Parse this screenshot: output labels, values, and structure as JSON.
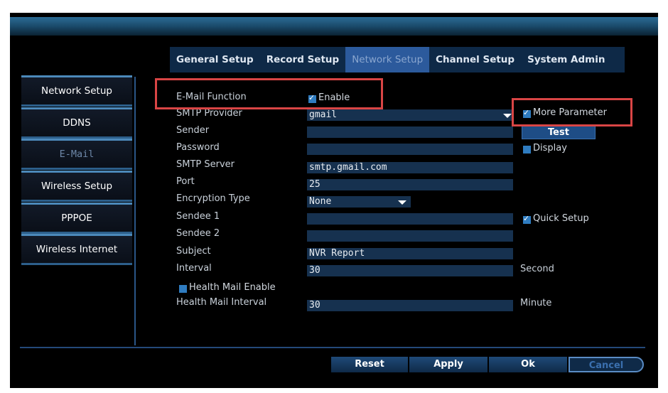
{
  "tabs": [
    {
      "label": "General Setup",
      "active": false
    },
    {
      "label": "Record Setup",
      "active": false
    },
    {
      "label": "Network Setup",
      "active": true
    },
    {
      "label": "Channel Setup",
      "active": false
    },
    {
      "label": "System Admin",
      "active": false
    }
  ],
  "sidebar": [
    {
      "label": "Network Setup",
      "active": false
    },
    {
      "label": "DDNS",
      "active": false
    },
    {
      "label": "E-Mail",
      "active": true
    },
    {
      "label": "Wireless Setup",
      "active": false
    },
    {
      "label": "PPPOE",
      "active": false
    },
    {
      "label": "Wireless Internet",
      "active": false
    }
  ],
  "email": {
    "function_label": "E-Mail Function",
    "enable_label": "Enable",
    "enable_checked": true,
    "smtp_provider_label": "SMTP Provider",
    "smtp_provider_value": "gmail",
    "more_parameter_label": "More Parameter",
    "more_parameter_checked": true,
    "sender_label": "Sender",
    "sender_value": "",
    "test_button": "Test",
    "password_label": "Password",
    "password_value": "",
    "display_label": "Display",
    "display_checked": false,
    "smtp_server_label": "SMTP Server",
    "smtp_server_value": "smtp.gmail.com",
    "port_label": "Port",
    "port_value": "25",
    "encryption_label": "Encryption Type",
    "encryption_value": "None",
    "sendee1_label": "Sendee 1",
    "sendee1_value": "",
    "quick_setup_label": "Quick Setup",
    "quick_setup_checked": true,
    "sendee2_label": "Sendee 2",
    "sendee2_value": "",
    "subject_label": "Subject",
    "subject_value": "NVR Report",
    "interval_label": "Interval",
    "interval_value": "30",
    "interval_unit": "Second",
    "health_mail_enable_label": "Health Mail Enable",
    "health_mail_enable_checked": false,
    "health_mail_interval_label": "Health Mail Interval",
    "health_mail_interval_value": "30",
    "health_mail_interval_unit": "Minute"
  },
  "footer": {
    "reset": "Reset",
    "apply": "Apply",
    "ok": "Ok",
    "cancel": "Cancel"
  },
  "colors": {
    "highlight_box": "#d94545",
    "accent": "#2c5a9c",
    "background": "#000000"
  }
}
